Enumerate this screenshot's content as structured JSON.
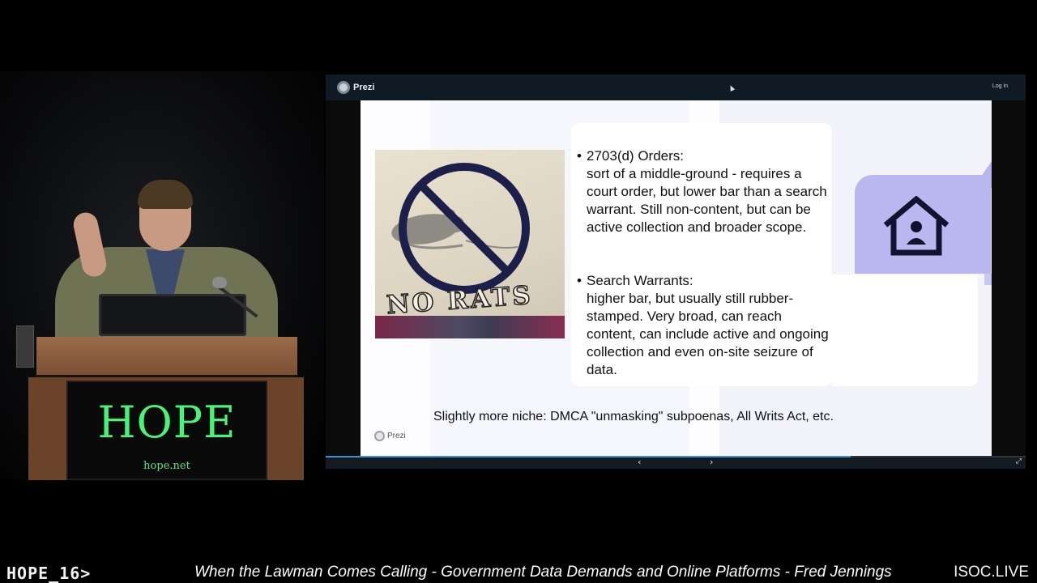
{
  "prezi": {
    "brand": "Prezi",
    "login_label": "Log in",
    "progress_fraction": 0.75,
    "prev_label": "‹",
    "next_label": "›",
    "fullscreen_label": "⤢"
  },
  "slide": {
    "image": {
      "alt_text": "NO RATS",
      "icon": "no-rats-sign"
    },
    "bullets": [
      {
        "marker": "•",
        "heading": "2703(d) Orders:",
        "text": "2703(d) Orders:\nsort of a middle-ground - requires a court order, but lower bar than a search warrant. Still non-content, but can be active collection and broader scope."
      },
      {
        "marker": "•",
        "heading": "Search Warrants:",
        "text": "Search Warrants:\nhigher bar, but usually still rubber-stamped. Very broad, can reach content, can include active and ongoing collection and even on-site seizure of data."
      }
    ],
    "home_icon": "house-person-icon",
    "accent_color": "#b8b7ef",
    "footnote": "Slightly more niche: DMCA \"unmasking\" subpoenas, All Writs Act, etc.",
    "watermark": "Prezi"
  },
  "podium": {
    "logo": "HOPE",
    "url": "hope.net",
    "logo_color": "#49f27a"
  },
  "lower_third": {
    "event": "HOPE_16>",
    "title": "When the Lawman Comes Calling - Government Data Demands and Online Platforms - Fred Jennings",
    "brand": "ISOC.LIVE"
  }
}
